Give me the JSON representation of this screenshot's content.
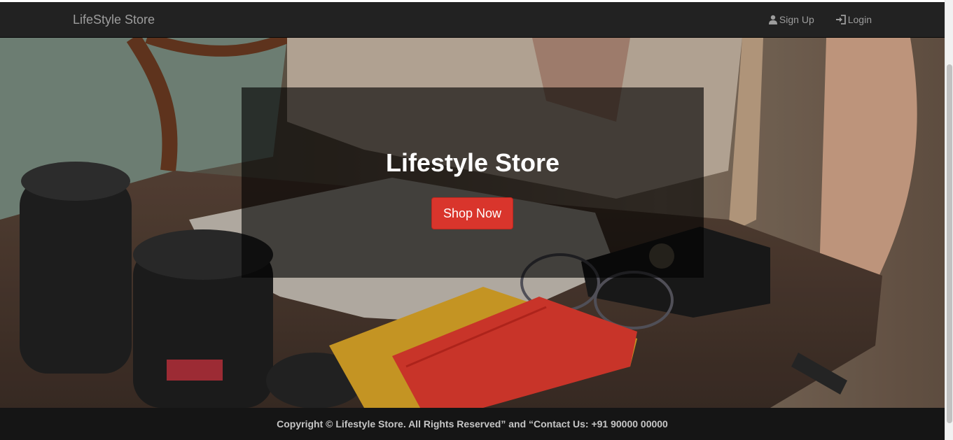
{
  "navbar": {
    "brand": "LifeStyle Store",
    "links": [
      {
        "label": "Sign Up",
        "icon": "user-icon"
      },
      {
        "label": "Login",
        "icon": "login-icon"
      }
    ]
  },
  "hero": {
    "title": "Lifestyle Store",
    "cta_label": "Shop Now",
    "image": "lifestyle-products-on-table"
  },
  "footer": {
    "text": "Copyright © Lifestyle Store. All Rights Reserved” and “Contact Us: +91 90000 00000"
  },
  "colors": {
    "navbar_bg": "#222222",
    "nav_text": "#9d9d9d",
    "cta_bg": "#d9352c",
    "footer_bg": "#151515"
  }
}
